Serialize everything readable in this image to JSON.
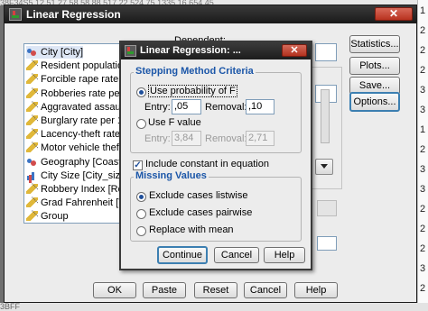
{
  "background": {
    "top_row": "38F34S5           12,51          27,58        58,88 517,22        524,75    1335,16          654,45",
    "right_digits": [
      "1",
      "2",
      "2",
      "2",
      "3",
      "3",
      "1",
      "2",
      "3",
      "3",
      "2",
      "2",
      "2",
      "3",
      "2"
    ],
    "bottom_row": "3BFF"
  },
  "main_window": {
    "title": "Linear Regression",
    "close_label": "✕",
    "dependent_label": "Dependent:",
    "variables": [
      {
        "label": "City [City]",
        "icon": "nominal-variable-icon"
      },
      {
        "label": "Resident population [Po",
        "icon": "scale-variable-icon"
      },
      {
        "label": "Forcible rape rate per",
        "icon": "scale-variable-icon"
      },
      {
        "label": "Robberies rate per 100,",
        "icon": "scale-variable-icon"
      },
      {
        "label": "Aggravated assault ra",
        "icon": "scale-variable-icon"
      },
      {
        "label": "Burglary rate per 100,0",
        "icon": "scale-variable-icon"
      },
      {
        "label": "Lacency-theft rate per",
        "icon": "scale-variable-icon"
      },
      {
        "label": "Motor vehicle theft rate",
        "icon": "scale-variable-icon"
      },
      {
        "label": "Geography [Coast]",
        "icon": "nominal-variable-icon"
      },
      {
        "label": "City Size [City_size]",
        "icon": "ordinal-variable-icon"
      },
      {
        "label": "Robbery Index [Robbe",
        "icon": "scale-variable-icon"
      },
      {
        "label": "Grad Fahrenheit [Temp",
        "icon": "scale-variable-icon"
      },
      {
        "label": "Group",
        "icon": "scale-variable-icon"
      }
    ],
    "side_buttons": [
      "Statistics...",
      "Plots...",
      "Save...",
      "Options..."
    ],
    "bottom_buttons": [
      "OK",
      "Paste",
      "Reset",
      "Cancel",
      "Help"
    ]
  },
  "options_dialog": {
    "title": "Linear Regression: ...",
    "close_label": "✕",
    "stepping": {
      "title": "Stepping Method Criteria",
      "use_probability_label": "Use probability of F",
      "use_f_value_label": "Use F value",
      "prob_entry_label": "Entry:",
      "prob_entry_value": ",05",
      "prob_removal_label": "Removal:",
      "prob_removal_value": ",10",
      "f_entry_label": "Entry:",
      "f_entry_value": "3,84",
      "f_removal_label": "Removal:",
      "f_removal_value": "2,71"
    },
    "include_constant_label": "Include constant in equation",
    "missing": {
      "title": "Missing Values",
      "listwise_label": "Exclude cases listwise",
      "pairwise_label": "Exclude cases pairwise",
      "replace_label": "Replace with mean"
    },
    "buttons": {
      "continue": "Continue",
      "cancel": "Cancel",
      "help": "Help"
    }
  }
}
